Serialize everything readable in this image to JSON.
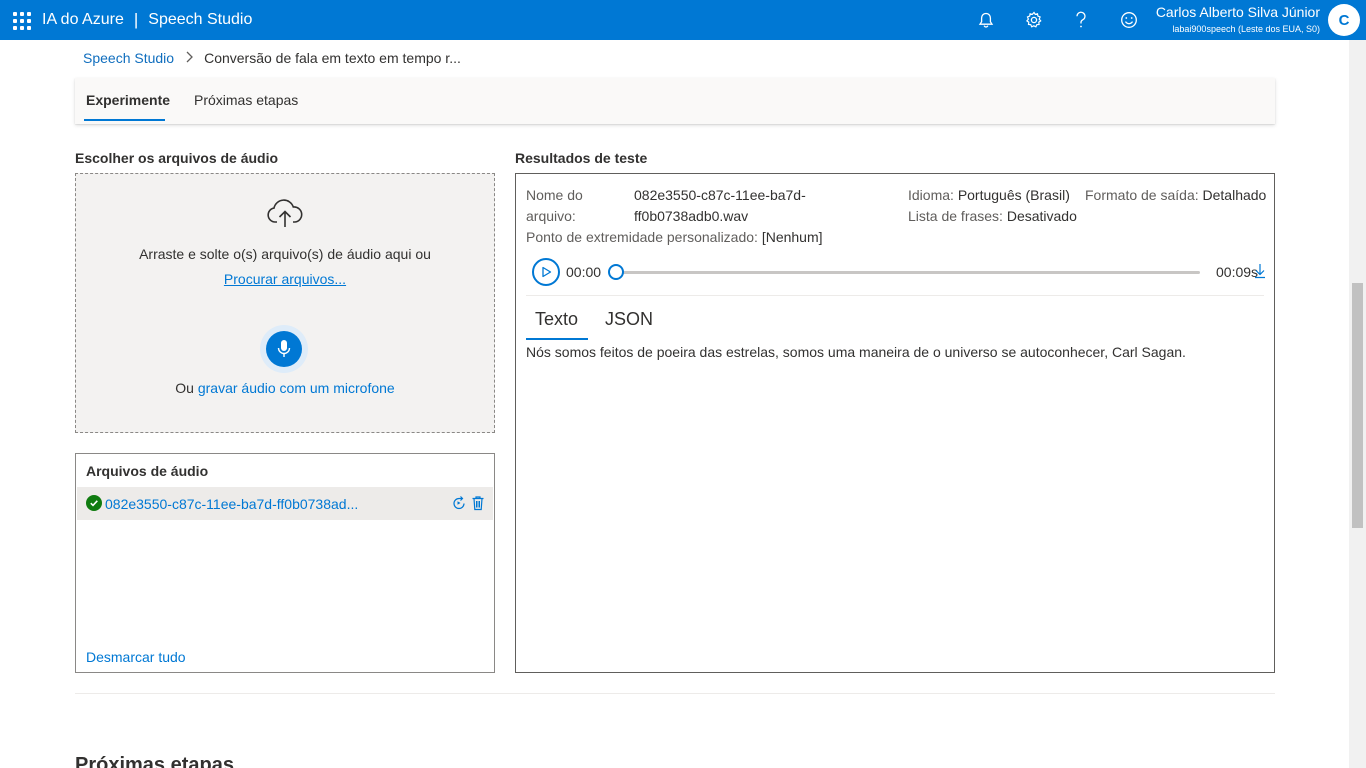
{
  "topbar": {
    "brand": "IA do Azure",
    "separator": "|",
    "product": "Speech Studio",
    "icons": [
      "bell-icon",
      "gear-icon",
      "help-icon",
      "feedback-smile-icon"
    ],
    "user_name": "Carlos Alberto Silva Júnior",
    "user_sub": "labai900speech (Leste dos EUA, S0)",
    "avatar_initial": "C"
  },
  "breadcrumb": {
    "root": "Speech Studio",
    "current": "Conversão de fala em texto em tempo r..."
  },
  "tabs": {
    "items": [
      "Experimente",
      "Próximas etapas"
    ],
    "active": "Experimente"
  },
  "left": {
    "title": "Escolher os arquivos de áudio",
    "drop_text": "Arraste e solte o(s) arquivo(s) de áudio aqui ou",
    "browse_link": "Procurar arquivos...",
    "record_prefix": "Ou ",
    "record_link": "gravar áudio com um microfone"
  },
  "files": {
    "header": "Arquivos de áudio",
    "items": [
      {
        "name": "082e3550-c87c-11ee-ba7d-ff0b0738ad...",
        "status": "success"
      }
    ],
    "unselect_all": "Desmarcar tudo"
  },
  "results": {
    "title": "Resultados de teste",
    "file_label_1": "Nome do",
    "file_label_2": "arquivo:",
    "file_value_1": "082e3550-c87c-11ee-ba7d-",
    "file_value_2": "ff0b0738adb0.wav",
    "language_label": "Idioma:",
    "language_value": "Português (Brasil)",
    "format_label": "Formato de saída:",
    "format_value": "Detalhado",
    "phrase_label": "Lista de frases:",
    "phrase_value": "Desativado",
    "endpoint_label": "Ponto de extremidade personalizado:",
    "endpoint_value": "[Nenhum]",
    "player": {
      "current": "00:00",
      "total": "00:09s",
      "progress": 0
    },
    "tabs": [
      "Texto",
      "JSON"
    ],
    "active_tab": "Texto",
    "transcript": "Nós somos feitos de poeira das estrelas, somos uma maneira de o universo se autoconhecer, Carl Sagan."
  },
  "next_steps": {
    "title": "Próximas etapas"
  },
  "colors": {
    "topbar": "#0078d4",
    "link": "#0078d4",
    "success": "#107c10"
  }
}
